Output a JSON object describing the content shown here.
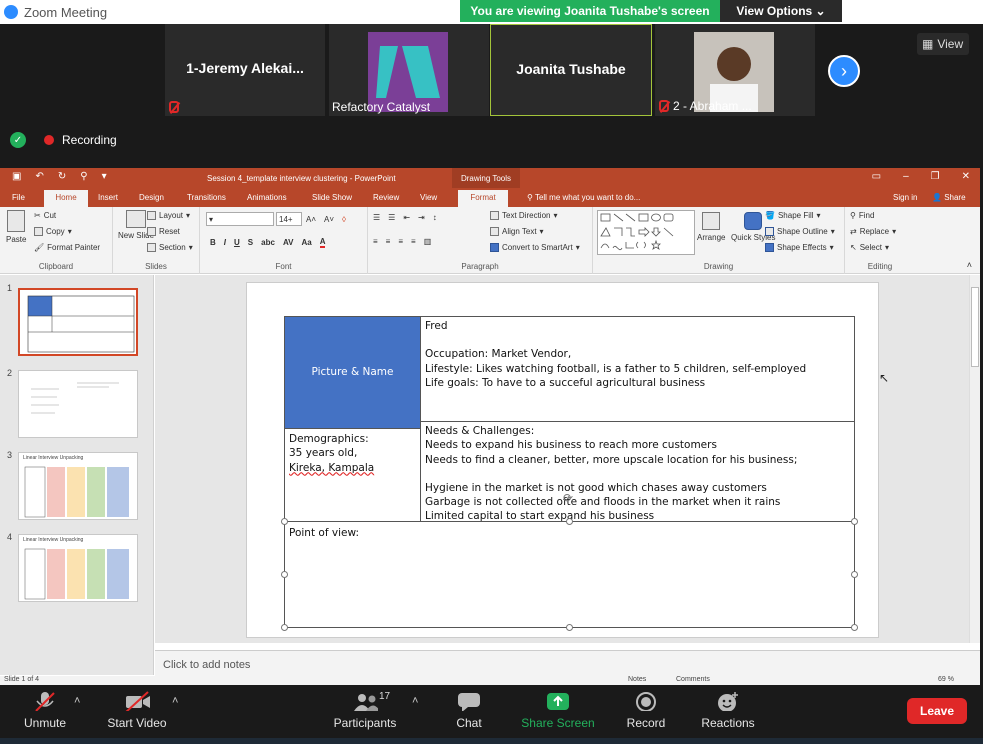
{
  "zoom": {
    "window_title": "Zoom Meeting",
    "banner_text": "You are viewing Joanita Tushabe's screen",
    "view_options": "View Options",
    "view_label": "View",
    "recording": "Recording",
    "participants_count": "17",
    "tiles": [
      {
        "name": "1-Jeremy  Alekai...",
        "label": ""
      },
      {
        "name": "",
        "label": "Refactory Catalyst"
      },
      {
        "name": "Joanita Tushabe",
        "label": ""
      },
      {
        "name": "",
        "label": "2 - Abraham ..."
      }
    ],
    "toolbar": {
      "unmute": "Unmute",
      "start_video": "Start Video",
      "participants": "Participants",
      "chat": "Chat",
      "share_screen": "Share Screen",
      "record": "Record",
      "reactions": "Reactions",
      "leave": "Leave"
    },
    "colors": {
      "accent": "#2d8cff",
      "share": "#23b05c",
      "leave": "#e02828"
    }
  },
  "ppt": {
    "title": "Session 4_template interview clustering - PowerPoint",
    "drawing_tools": "Drawing Tools",
    "tabs": [
      "File",
      "Home",
      "Insert",
      "Design",
      "Transitions",
      "Animations",
      "Slide Show",
      "Review",
      "View",
      "Format"
    ],
    "tell_me": "Tell me what you want to do...",
    "sign_in": "Sign in",
    "share": "Share",
    "ribbon": {
      "paste": "Paste",
      "cut": "Cut",
      "copy": "Copy",
      "format_painter": "Format Painter",
      "clipboard": "Clipboard",
      "new_slide": "New Slide",
      "layout": "Layout",
      "reset": "Reset",
      "section": "Section",
      "slides": "Slides",
      "font_size": "14+",
      "font": "Font",
      "text_direction": "Text Direction",
      "align_text": "Align Text",
      "convert_smartart": "Convert to SmartArt",
      "paragraph": "Paragraph",
      "arrange": "Arrange",
      "quick_styles": "Quick Styles",
      "shape_fill": "Shape Fill",
      "shape_outline": "Shape Outline",
      "shape_effects": "Shape Effects",
      "drawing": "Drawing",
      "find": "Find",
      "replace": "Replace",
      "select": "Select",
      "editing": "Editing"
    },
    "thumbnails": [
      "1",
      "2",
      "3",
      "4"
    ],
    "thumb_titles": {
      "t3": "Linear Interview Unpacking",
      "t4": "Linear Interview Unpacking"
    },
    "slide": {
      "picture_name": "Picture & Name",
      "profile": [
        "Fred",
        "",
        "Occupation: Market Vendor,",
        "Lifestyle: Likes watching football, is a father to 5 children, self-employed",
        "Life goals: To have to a succeful agricultural business"
      ],
      "demographics": [
        "Demographics:",
        "35 years old,",
        "Kireka, Kampala"
      ],
      "needs": [
        "Needs & Challenges:",
        "Needs to expand his business to reach more customers",
        "Needs to find a cleaner, better, more upscale location for his business;",
        "",
        "Hygiene in the market is not good which chases away customers",
        "Garbage is not collected ofte  and floods in the market when it rains",
        "Limited capital to start expand his business"
      ],
      "point_of_view": "Point of view:"
    },
    "notes_placeholder": "Click to add notes",
    "status": {
      "slide_of": "Slide 1 of 4",
      "notes": "Notes",
      "comments": "Comments",
      "zoom": "69 %"
    }
  }
}
